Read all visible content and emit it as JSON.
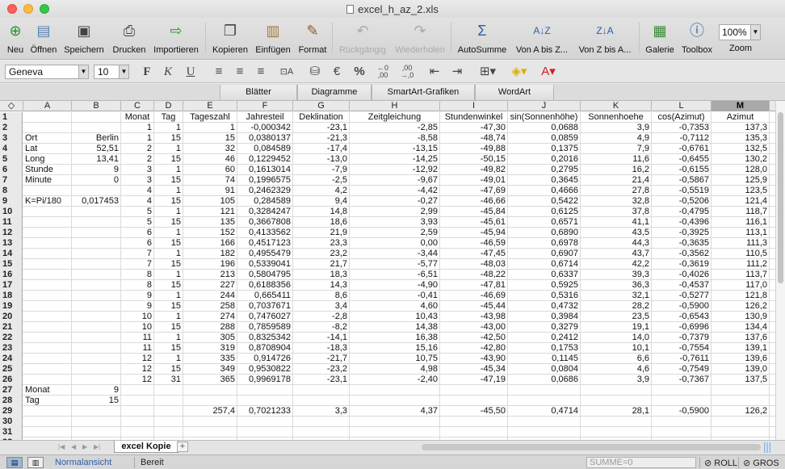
{
  "window": {
    "title": "excel_h_az_2.xls"
  },
  "toolbar": {
    "neu": "Neu",
    "oeffnen": "Öffnen",
    "speichern": "Speichern",
    "drucken": "Drucken",
    "importieren": "Importieren",
    "kopieren": "Kopieren",
    "einfuegen": "Einfügen",
    "format": "Format",
    "rueckgaengig": "Rückgängig",
    "wiederholen": "Wiederholen",
    "autosumme": "AutoSumme",
    "sort_az": "Von A bis Z...",
    "sort_za": "Von Z bis A...",
    "galerie": "Galerie",
    "toolbox": "Toolbox",
    "zoom_label": "Zoom",
    "zoom_value": "100%"
  },
  "format_bar": {
    "font": "Geneva",
    "size": "10"
  },
  "ribbon": {
    "tabs": [
      "Blätter",
      "Diagramme",
      "SmartArt-Grafiken",
      "WordArt"
    ]
  },
  "sheet": {
    "columns": [
      "A",
      "B",
      "C",
      "D",
      "E",
      "F",
      "G",
      "H",
      "I",
      "J",
      "K",
      "L",
      "M"
    ],
    "selected_column": "M",
    "rows": [
      [
        "1",
        "",
        "",
        "Monat",
        "Tag",
        "Tageszahl",
        "Jahresteil",
        "Deklination",
        "Zeitgleichung",
        "Stundenwinkel",
        "sin(Sonnenhöhe)",
        "Sonnenhoehe",
        "cos(Azimut)",
        "Azimut"
      ],
      [
        "2",
        "",
        "",
        "1",
        "1",
        "1",
        "-0,000342",
        "-23,1",
        "-2,85",
        "-47,30",
        "0,0688",
        "3,9",
        "-0,7353",
        "137,3"
      ],
      [
        "3",
        "Ort",
        "Berlin",
        "1",
        "15",
        "15",
        "0,0380137",
        "-21,3",
        "-8,58",
        "-48,74",
        "0,0859",
        "4,9",
        "-0,7112",
        "135,3"
      ],
      [
        "4",
        "Lat",
        "52,51",
        "2",
        "1",
        "32",
        "0,084589",
        "-17,4",
        "-13,15",
        "-49,88",
        "0,1375",
        "7,9",
        "-0,6761",
        "132,5"
      ],
      [
        "5",
        "Long",
        "13,41",
        "2",
        "15",
        "46",
        "0,1229452",
        "-13,0",
        "-14,25",
        "-50,15",
        "0,2016",
        "11,6",
        "-0,6455",
        "130,2"
      ],
      [
        "6",
        "Stunde",
        "9",
        "3",
        "1",
        "60",
        "0,1613014",
        "-7,9",
        "-12,92",
        "-49,82",
        "0,2795",
        "16,2",
        "-0,6155",
        "128,0"
      ],
      [
        "7",
        "Minute",
        "0",
        "3",
        "15",
        "74",
        "0,1996575",
        "-2,5",
        "-9,67",
        "-49,01",
        "0,3645",
        "21,4",
        "-0,5867",
        "125,9"
      ],
      [
        "8",
        "",
        "",
        "4",
        "1",
        "91",
        "0,2462329",
        "4,2",
        "-4,42",
        "-47,69",
        "0,4666",
        "27,8",
        "-0,5519",
        "123,5"
      ],
      [
        "9",
        "K=Pi/180",
        "0,017453",
        "4",
        "15",
        "105",
        "0,284589",
        "9,4",
        "-0,27",
        "-46,66",
        "0,5422",
        "32,8",
        "-0,5206",
        "121,4"
      ],
      [
        "10",
        "",
        "",
        "5",
        "1",
        "121",
        "0,3284247",
        "14,8",
        "2,99",
        "-45,84",
        "0,6125",
        "37,8",
        "-0,4795",
        "118,7"
      ],
      [
        "11",
        "",
        "",
        "5",
        "15",
        "135",
        "0,3667808",
        "18,6",
        "3,93",
        "-45,61",
        "0,6571",
        "41,1",
        "-0,4396",
        "116,1"
      ],
      [
        "12",
        "",
        "",
        "6",
        "1",
        "152",
        "0,4133562",
        "21,9",
        "2,59",
        "-45,94",
        "0,6890",
        "43,5",
        "-0,3925",
        "113,1"
      ],
      [
        "13",
        "",
        "",
        "6",
        "15",
        "166",
        "0,4517123",
        "23,3",
        "0,00",
        "-46,59",
        "0,6978",
        "44,3",
        "-0,3635",
        "111,3"
      ],
      [
        "14",
        "",
        "",
        "7",
        "1",
        "182",
        "0,4955479",
        "23,2",
        "-3,44",
        "-47,45",
        "0,6907",
        "43,7",
        "-0,3562",
        "110,5"
      ],
      [
        "15",
        "",
        "",
        "7",
        "15",
        "196",
        "0,5339041",
        "21,7",
        "-5,77",
        "-48,03",
        "0,6714",
        "42,2",
        "-0,3619",
        "111,2"
      ],
      [
        "16",
        "",
        "",
        "8",
        "1",
        "213",
        "0,5804795",
        "18,3",
        "-6,51",
        "-48,22",
        "0,6337",
        "39,3",
        "-0,4026",
        "113,7"
      ],
      [
        "17",
        "",
        "",
        "8",
        "15",
        "227",
        "0,6188356",
        "14,3",
        "-4,90",
        "-47,81",
        "0,5925",
        "36,3",
        "-0,4537",
        "117,0"
      ],
      [
        "18",
        "",
        "",
        "9",
        "1",
        "244",
        "0,665411",
        "8,6",
        "-0,41",
        "-46,69",
        "0,5316",
        "32,1",
        "-0,5277",
        "121,8"
      ],
      [
        "19",
        "",
        "",
        "9",
        "15",
        "258",
        "0,7037671",
        "3,4",
        "4,60",
        "-45,44",
        "0,4732",
        "28,2",
        "-0,5900",
        "126,2"
      ],
      [
        "20",
        "",
        "",
        "10",
        "1",
        "274",
        "0,7476027",
        "-2,8",
        "10,43",
        "-43,98",
        "0,3984",
        "23,5",
        "-0,6543",
        "130,9"
      ],
      [
        "21",
        "",
        "",
        "10",
        "15",
        "288",
        "0,7859589",
        "-8,2",
        "14,38",
        "-43,00",
        "0,3279",
        "19,1",
        "-0,6996",
        "134,4"
      ],
      [
        "22",
        "",
        "",
        "11",
        "1",
        "305",
        "0,8325342",
        "-14,1",
        "16,38",
        "-42,50",
        "0,2412",
        "14,0",
        "-0,7379",
        "137,6"
      ],
      [
        "23",
        "",
        "",
        "11",
        "15",
        "319",
        "0,8708904",
        "-18,3",
        "15,16",
        "-42,80",
        "0,1753",
        "10,1",
        "-0,7554",
        "139,1"
      ],
      [
        "24",
        "",
        "",
        "12",
        "1",
        "335",
        "0,914726",
        "-21,7",
        "10,75",
        "-43,90",
        "0,1145",
        "6,6",
        "-0,7611",
        "139,6"
      ],
      [
        "25",
        "",
        "",
        "12",
        "15",
        "349",
        "0,9530822",
        "-23,2",
        "4,98",
        "-45,34",
        "0,0804",
        "4,6",
        "-0,7549",
        "139,0"
      ],
      [
        "26",
        "",
        "",
        "12",
        "31",
        "365",
        "0,9969178",
        "-23,1",
        "-2,40",
        "-47,19",
        "0,0686",
        "3,9",
        "-0,7367",
        "137,5"
      ],
      [
        "27",
        "Monat",
        "9",
        "",
        "",
        "",
        "",
        "",
        "",
        "",
        "",
        "",
        "",
        ""
      ],
      [
        "28",
        "Tag",
        "15",
        "",
        "",
        "",
        "",
        "",
        "",
        "",
        "",
        "",
        "",
        ""
      ],
      [
        "29",
        "",
        "",
        "",
        "",
        "257,4",
        "0,7021233",
        "3,3",
        "4,37",
        "-45,50",
        "0,4714",
        "28,1",
        "-0,5900",
        "126,2"
      ],
      [
        "30",
        "",
        "",
        "",
        "",
        "",
        "",
        "",
        "",
        "",
        "",
        "",
        "",
        ""
      ],
      [
        "31",
        "",
        "",
        "",
        "",
        "",
        "",
        "",
        "",
        "",
        "",
        "",
        "",
        ""
      ],
      [
        "32",
        "",
        "",
        "",
        "",
        "",
        "",
        "",
        "",
        "",
        "",
        "",
        "",
        ""
      ]
    ]
  },
  "sheet_tabs": {
    "active": "excel Kopie",
    "add": "+"
  },
  "status": {
    "view": "Normalansicht",
    "ready": "Bereit",
    "sum": "SUMME=0",
    "roll": "ROLL",
    "gros": "GROS"
  }
}
